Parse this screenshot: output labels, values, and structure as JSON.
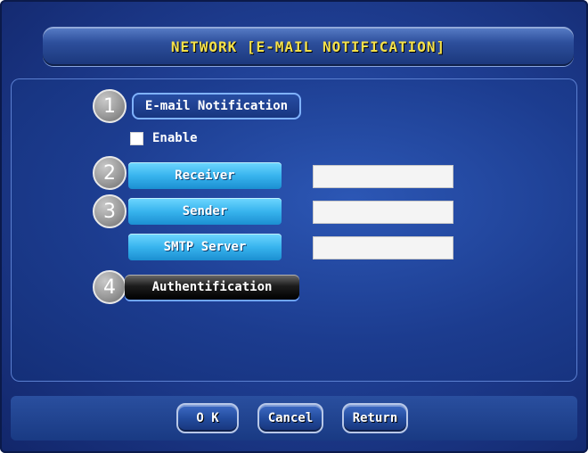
{
  "header": {
    "title": "NETWORK [E-MAIL NOTIFICATION]"
  },
  "callouts": {
    "c1": "1",
    "c2": "2",
    "c3": "3",
    "c4": "4"
  },
  "section": {
    "label": "E-mail Notification"
  },
  "enable": {
    "label": "Enable",
    "checked": true
  },
  "fields": {
    "receiver": {
      "label": "Receiver",
      "value": ""
    },
    "sender": {
      "label": "Sender",
      "value": ""
    },
    "smtp": {
      "label": "SMTP Server",
      "value": ""
    }
  },
  "auth": {
    "label": "Authentification"
  },
  "footer": {
    "ok": "O K",
    "cancel": "Cancel",
    "return": "Return"
  },
  "colors": {
    "title_text": "#f5e14a",
    "label_box": "#38b4ee",
    "background": "#1f3f94"
  }
}
